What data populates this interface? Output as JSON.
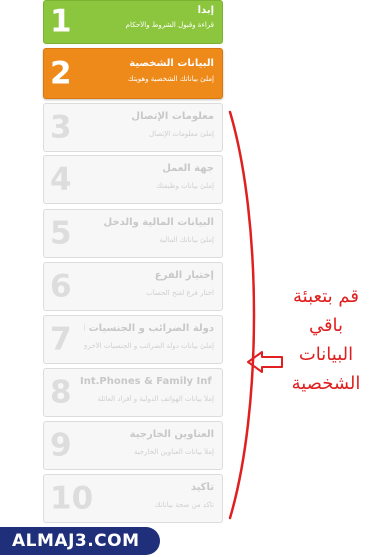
{
  "steps": [
    {
      "number": "1",
      "title": "إبدأ",
      "subtitle": "قراءة وقبول الشروط والأحكام",
      "state": "done"
    },
    {
      "number": "2",
      "title": "البيانات الشخصية",
      "subtitle": "إملئ بياناتك الشخصية وهويتك",
      "state": "active"
    },
    {
      "number": "3",
      "title": "معلومات الإتصال",
      "subtitle": "إملئ معلومات الإتصال",
      "state": "pending"
    },
    {
      "number": "4",
      "title": "جهة العمل",
      "subtitle": "إملئ بيانات وظيفتك",
      "state": "pending"
    },
    {
      "number": "5",
      "title": "البيانات المالية والدخل",
      "subtitle": "إملئ بياناتك المالية",
      "state": "pending"
    },
    {
      "number": "6",
      "title": "إختيار الفرع",
      "subtitle": "اختار فرع لفتح الحساب",
      "state": "pending"
    },
    {
      "number": "7",
      "title": "دولة الضرائب و الجنسيات الأخرى",
      "subtitle": "إملئ بيانات دولة الضرائب و الجنسيات الأخرى",
      "state": "pending"
    },
    {
      "number": "8",
      "title": "Int.Phones & Family Inf",
      "subtitle": "إملأ بيانات الهواتف الدولية و أفراد العائلة",
      "state": "pending"
    },
    {
      "number": "9",
      "title": "العناوين الخارجية",
      "subtitle": "إملأ بيانات العناوين الخارجية",
      "state": "pending"
    },
    {
      "number": "10",
      "title": "تأكيد",
      "subtitle": "تأكد من صحة بياناتك",
      "state": "pending"
    }
  ],
  "annotation": {
    "lines": [
      "قم بتعبئة",
      "باقي",
      "البيانات",
      "الشخصية"
    ],
    "color": "#e02020"
  },
  "watermark": {
    "text": "ALMAJ3.COM"
  },
  "colors": {
    "done": "#8cc63e",
    "active": "#ee8a1a",
    "pending": "#f7f7f7"
  }
}
